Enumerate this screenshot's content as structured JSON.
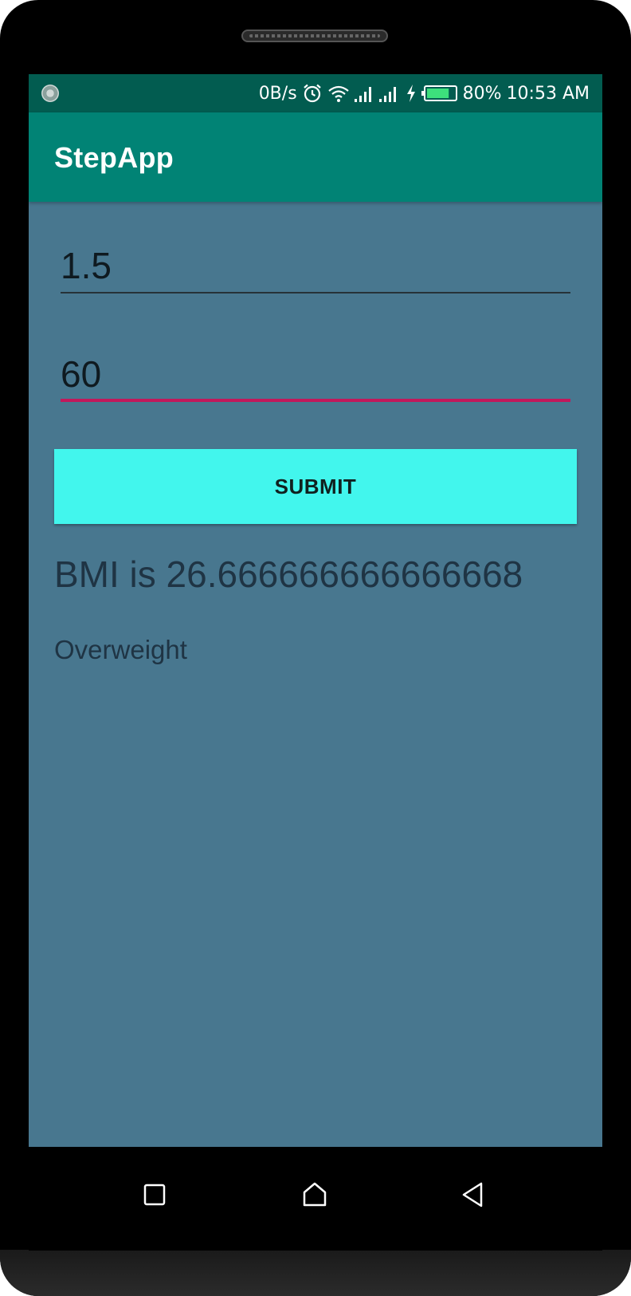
{
  "status_bar": {
    "network_speed": "0B/s",
    "battery_percent": "80%",
    "battery_level": 0.8,
    "time": "10:53 AM",
    "icons": [
      "app-notification-icon",
      "alarm-icon",
      "wifi-icon",
      "signal-icon",
      "charging-icon",
      "battery-icon"
    ]
  },
  "app_bar": {
    "title": "StepApp"
  },
  "form": {
    "height_value": "1.5",
    "weight_value": "60",
    "submit_label": "SUBMIT"
  },
  "result": {
    "bmi_text": "BMI is 26.666666666666668",
    "category": "Overweight"
  },
  "nav": {
    "icons": [
      "recent-apps-icon",
      "home-icon",
      "back-icon"
    ]
  },
  "colors": {
    "status_bar": "#025c50",
    "app_bar": "#018375",
    "background": "#48778f",
    "button": "#42f6ed",
    "focus_underline": "#c2185b"
  }
}
